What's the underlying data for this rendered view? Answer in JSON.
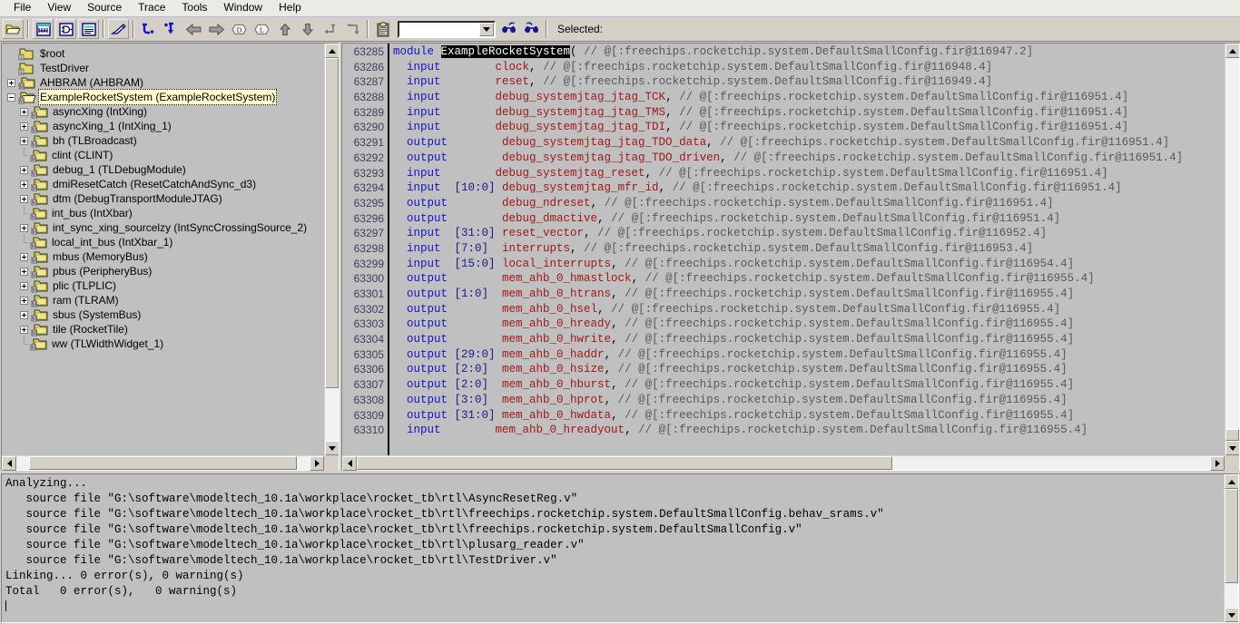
{
  "menu": {
    "items": [
      "File",
      "View",
      "Source",
      "Trace",
      "Tools",
      "Window",
      "Help"
    ]
  },
  "toolbar": {
    "buttons": [
      {
        "name": "open-folder-icon",
        "label": "Open"
      },
      {
        "name": "waveform-view-icon",
        "label": "Wave"
      },
      {
        "name": "schematic-view-icon",
        "label": "Schematic"
      },
      {
        "name": "list-view-icon",
        "label": "List"
      },
      {
        "name": "annotate-icon",
        "label": "Annotate"
      },
      {
        "name": "trace-forward-icon",
        "label": "Trace Forward"
      },
      {
        "name": "trace-backward-icon",
        "label": "Trace Backward"
      },
      {
        "name": "back-arrow-icon",
        "label": "Back"
      },
      {
        "name": "forward-arrow-icon",
        "label": "Forward"
      },
      {
        "name": "driver-icon",
        "label": "Show Drivers"
      },
      {
        "name": "load-icon",
        "label": "Show Loads"
      },
      {
        "name": "up-arrow-icon",
        "label": "Up"
      },
      {
        "name": "down-arrow-icon",
        "label": "Down"
      },
      {
        "name": "step-out-icon",
        "label": "Step Out"
      },
      {
        "name": "step-into-icon",
        "label": "Step Into"
      },
      {
        "name": "clipboard-icon",
        "label": "Paste Signal"
      }
    ],
    "combo_value": "",
    "combo_placeholder": "",
    "find_forward_icon": "binoculars-forward-icon",
    "find_backward_icon": "binoculars-backward-icon",
    "selected_label": "Selected:"
  },
  "tree": {
    "items": [
      {
        "indent": 1,
        "expander": "none",
        "icon": "root-folder-icon",
        "label": "$root",
        "selected": false
      },
      {
        "indent": 1,
        "expander": "none",
        "icon": "root-folder-icon",
        "label": "TestDriver",
        "selected": false
      },
      {
        "indent": 1,
        "expander": "plus",
        "icon": "module-folder-icon",
        "label": "AHBRAM (AHBRAM)",
        "selected": false
      },
      {
        "indent": 1,
        "expander": "minus",
        "icon": "module-open-folder-icon",
        "label": "ExampleRocketSystem (ExampleRocketSystem)",
        "selected": true
      },
      {
        "indent": 2,
        "expander": "plus",
        "icon": "module-folder-icon",
        "label": "asyncXing (IntXing)",
        "selected": false
      },
      {
        "indent": 2,
        "expander": "plus",
        "icon": "module-folder-icon",
        "label": "asyncXing_1 (IntXing_1)",
        "selected": false
      },
      {
        "indent": 2,
        "expander": "plus",
        "icon": "module-folder-icon",
        "label": "bh (TLBroadcast)",
        "selected": false
      },
      {
        "indent": 2,
        "expander": "leaf",
        "icon": "module-folder-icon",
        "label": "clint (CLINT)",
        "selected": false
      },
      {
        "indent": 2,
        "expander": "plus",
        "icon": "module-folder-icon",
        "label": "debug_1 (TLDebugModule)",
        "selected": false
      },
      {
        "indent": 2,
        "expander": "plus",
        "icon": "module-folder-icon",
        "label": "dmiResetCatch (ResetCatchAndSync_d3)",
        "selected": false
      },
      {
        "indent": 2,
        "expander": "plus",
        "icon": "module-folder-icon",
        "label": "dtm (DebugTransportModuleJTAG)",
        "selected": false
      },
      {
        "indent": 2,
        "expander": "leaf",
        "icon": "module-folder-icon",
        "label": "int_bus (IntXbar)",
        "selected": false
      },
      {
        "indent": 2,
        "expander": "plus",
        "icon": "module-folder-icon",
        "label": "int_sync_xing_sourcelzy (IntSyncCrossingSource_2)",
        "selected": false
      },
      {
        "indent": 2,
        "expander": "leaf",
        "icon": "module-folder-icon",
        "label": "local_int_bus (IntXbar_1)",
        "selected": false
      },
      {
        "indent": 2,
        "expander": "plus",
        "icon": "module-folder-icon",
        "label": "mbus (MemoryBus)",
        "selected": false
      },
      {
        "indent": 2,
        "expander": "plus",
        "icon": "module-folder-icon",
        "label": "pbus (PeripheryBus)",
        "selected": false
      },
      {
        "indent": 2,
        "expander": "plus",
        "icon": "module-folder-icon",
        "label": "plic (TLPLIC)",
        "selected": false
      },
      {
        "indent": 2,
        "expander": "plus",
        "icon": "module-folder-icon",
        "label": "ram (TLRAM)",
        "selected": false
      },
      {
        "indent": 2,
        "expander": "plus",
        "icon": "module-folder-icon",
        "label": "sbus (SystemBus)",
        "selected": false
      },
      {
        "indent": 2,
        "expander": "plus",
        "icon": "module-folder-icon",
        "label": "tile (RocketTile)",
        "selected": false
      },
      {
        "indent": 2,
        "expander": "leaf",
        "icon": "module-folder-icon",
        "label": "ww (TLWidthWidget_1)",
        "selected": false
      }
    ]
  },
  "source": {
    "first_line": 63285,
    "lines": [
      {
        "num": "63285",
        "tokens": [
          {
            "t": "kw",
            "v": "module "
          },
          {
            "t": "sel",
            "v": "ExampleRocketSystem"
          },
          {
            "t": "punct",
            "v": "("
          },
          {
            "t": "cmt",
            "v": " // @[:freechips.rocketchip.system.DefaultSmallConfig.fir@116947.2]"
          }
        ]
      },
      {
        "num": "63286",
        "tokens": [
          {
            "t": "kw",
            "v": "  input "
          },
          {
            "t": "width",
            "v": "       "
          },
          {
            "t": "ident",
            "v": "clock"
          },
          {
            "t": "punct",
            "v": ","
          },
          {
            "t": "cmt",
            "v": " // @[:freechips.rocketchip.system.DefaultSmallConfig.fir@116948.4]"
          }
        ]
      },
      {
        "num": "63287",
        "tokens": [
          {
            "t": "kw",
            "v": "  input "
          },
          {
            "t": "width",
            "v": "       "
          },
          {
            "t": "ident",
            "v": "reset"
          },
          {
            "t": "punct",
            "v": ","
          },
          {
            "t": "cmt",
            "v": " // @[:freechips.rocketchip.system.DefaultSmallConfig.fir@116949.4]"
          }
        ]
      },
      {
        "num": "63288",
        "tokens": [
          {
            "t": "kw",
            "v": "  input "
          },
          {
            "t": "width",
            "v": "       "
          },
          {
            "t": "ident",
            "v": "debug_systemjtag_jtag_TCK"
          },
          {
            "t": "punct",
            "v": ","
          },
          {
            "t": "cmt",
            "v": " // @[:freechips.rocketchip.system.DefaultSmallConfig.fir@116951.4]"
          }
        ]
      },
      {
        "num": "63289",
        "tokens": [
          {
            "t": "kw",
            "v": "  input "
          },
          {
            "t": "width",
            "v": "       "
          },
          {
            "t": "ident",
            "v": "debug_systemjtag_jtag_TMS"
          },
          {
            "t": "punct",
            "v": ","
          },
          {
            "t": "cmt",
            "v": " // @[:freechips.rocketchip.system.DefaultSmallConfig.fir@116951.4]"
          }
        ]
      },
      {
        "num": "63290",
        "tokens": [
          {
            "t": "kw",
            "v": "  input "
          },
          {
            "t": "width",
            "v": "       "
          },
          {
            "t": "ident",
            "v": "debug_systemjtag_jtag_TDI"
          },
          {
            "t": "punct",
            "v": ","
          },
          {
            "t": "cmt",
            "v": " // @[:freechips.rocketchip.system.DefaultSmallConfig.fir@116951.4]"
          }
        ]
      },
      {
        "num": "63291",
        "tokens": [
          {
            "t": "kw",
            "v": "  output"
          },
          {
            "t": "width",
            "v": "       "
          },
          {
            "t": "ident",
            "v": " debug_systemjtag_jtag_TDO_data"
          },
          {
            "t": "punct",
            "v": ","
          },
          {
            "t": "cmt",
            "v": " // @[:freechips.rocketchip.system.DefaultSmallConfig.fir@116951.4]"
          }
        ]
      },
      {
        "num": "63292",
        "tokens": [
          {
            "t": "kw",
            "v": "  output"
          },
          {
            "t": "width",
            "v": "       "
          },
          {
            "t": "ident",
            "v": " debug_systemjtag_jtag_TDO_driven"
          },
          {
            "t": "punct",
            "v": ","
          },
          {
            "t": "cmt",
            "v": " // @[:freechips.rocketchip.system.DefaultSmallConfig.fir@116951.4]"
          }
        ]
      },
      {
        "num": "63293",
        "tokens": [
          {
            "t": "kw",
            "v": "  input "
          },
          {
            "t": "width",
            "v": "       "
          },
          {
            "t": "ident",
            "v": "debug_systemjtag_reset"
          },
          {
            "t": "punct",
            "v": ","
          },
          {
            "t": "cmt",
            "v": " // @[:freechips.rocketchip.system.DefaultSmallConfig.fir@116951.4]"
          }
        ]
      },
      {
        "num": "63294",
        "tokens": [
          {
            "t": "kw",
            "v": "  input "
          },
          {
            "t": "width",
            "v": " [10:0]"
          },
          {
            "t": "ident",
            "v": " debug_systemjtag_mfr_id"
          },
          {
            "t": "punct",
            "v": ","
          },
          {
            "t": "cmt",
            "v": " // @[:freechips.rocketchip.system.DefaultSmallConfig.fir@116951.4]"
          }
        ]
      },
      {
        "num": "63295",
        "tokens": [
          {
            "t": "kw",
            "v": "  output"
          },
          {
            "t": "width",
            "v": "       "
          },
          {
            "t": "ident",
            "v": " debug_ndreset"
          },
          {
            "t": "punct",
            "v": ","
          },
          {
            "t": "cmt",
            "v": " // @[:freechips.rocketchip.system.DefaultSmallConfig.fir@116951.4]"
          }
        ]
      },
      {
        "num": "63296",
        "tokens": [
          {
            "t": "kw",
            "v": "  output"
          },
          {
            "t": "width",
            "v": "       "
          },
          {
            "t": "ident",
            "v": " debug_dmactive"
          },
          {
            "t": "punct",
            "v": ","
          },
          {
            "t": "cmt",
            "v": " // @[:freechips.rocketchip.system.DefaultSmallConfig.fir@116951.4]"
          }
        ]
      },
      {
        "num": "63297",
        "tokens": [
          {
            "t": "kw",
            "v": "  input "
          },
          {
            "t": "width",
            "v": " [31:0]"
          },
          {
            "t": "ident",
            "v": " reset_vector"
          },
          {
            "t": "punct",
            "v": ","
          },
          {
            "t": "cmt",
            "v": " // @[:freechips.rocketchip.system.DefaultSmallConfig.fir@116952.4]"
          }
        ]
      },
      {
        "num": "63298",
        "tokens": [
          {
            "t": "kw",
            "v": "  input "
          },
          {
            "t": "width",
            "v": " [7:0] "
          },
          {
            "t": "ident",
            "v": " interrupts"
          },
          {
            "t": "punct",
            "v": ","
          },
          {
            "t": "cmt",
            "v": " // @[:freechips.rocketchip.system.DefaultSmallConfig.fir@116953.4]"
          }
        ]
      },
      {
        "num": "63299",
        "tokens": [
          {
            "t": "kw",
            "v": "  input "
          },
          {
            "t": "width",
            "v": " [15:0]"
          },
          {
            "t": "ident",
            "v": " local_interrupts"
          },
          {
            "t": "punct",
            "v": ","
          },
          {
            "t": "cmt",
            "v": " // @[:freechips.rocketchip.system.DefaultSmallConfig.fir@116954.4]"
          }
        ]
      },
      {
        "num": "63300",
        "tokens": [
          {
            "t": "kw",
            "v": "  output"
          },
          {
            "t": "width",
            "v": "       "
          },
          {
            "t": "ident",
            "v": " mem_ahb_0_hmastlock"
          },
          {
            "t": "punct",
            "v": ","
          },
          {
            "t": "cmt",
            "v": " // @[:freechips.rocketchip.system.DefaultSmallConfig.fir@116955.4]"
          }
        ]
      },
      {
        "num": "63301",
        "tokens": [
          {
            "t": "kw",
            "v": "  output"
          },
          {
            "t": "width",
            "v": " [1:0] "
          },
          {
            "t": "ident",
            "v": " mem_ahb_0_htrans"
          },
          {
            "t": "punct",
            "v": ","
          },
          {
            "t": "cmt",
            "v": " // @[:freechips.rocketchip.system.DefaultSmallConfig.fir@116955.4]"
          }
        ]
      },
      {
        "num": "63302",
        "tokens": [
          {
            "t": "kw",
            "v": "  output"
          },
          {
            "t": "width",
            "v": "       "
          },
          {
            "t": "ident",
            "v": " mem_ahb_0_hsel"
          },
          {
            "t": "punct",
            "v": ","
          },
          {
            "t": "cmt",
            "v": " // @[:freechips.rocketchip.system.DefaultSmallConfig.fir@116955.4]"
          }
        ]
      },
      {
        "num": "63303",
        "tokens": [
          {
            "t": "kw",
            "v": "  output"
          },
          {
            "t": "width",
            "v": "       "
          },
          {
            "t": "ident",
            "v": " mem_ahb_0_hready"
          },
          {
            "t": "punct",
            "v": ","
          },
          {
            "t": "cmt",
            "v": " // @[:freechips.rocketchip.system.DefaultSmallConfig.fir@116955.4]"
          }
        ]
      },
      {
        "num": "63304",
        "tokens": [
          {
            "t": "kw",
            "v": "  output"
          },
          {
            "t": "width",
            "v": "       "
          },
          {
            "t": "ident",
            "v": " mem_ahb_0_hwrite"
          },
          {
            "t": "punct",
            "v": ","
          },
          {
            "t": "cmt",
            "v": " // @[:freechips.rocketchip.system.DefaultSmallConfig.fir@116955.4]"
          }
        ]
      },
      {
        "num": "63305",
        "tokens": [
          {
            "t": "kw",
            "v": "  output"
          },
          {
            "t": "width",
            "v": " [29:0]"
          },
          {
            "t": "ident",
            "v": " mem_ahb_0_haddr"
          },
          {
            "t": "punct",
            "v": ","
          },
          {
            "t": "cmt",
            "v": " // @[:freechips.rocketchip.system.DefaultSmallConfig.fir@116955.4]"
          }
        ]
      },
      {
        "num": "63306",
        "tokens": [
          {
            "t": "kw",
            "v": "  output"
          },
          {
            "t": "width",
            "v": " [2:0] "
          },
          {
            "t": "ident",
            "v": " mem_ahb_0_hsize"
          },
          {
            "t": "punct",
            "v": ","
          },
          {
            "t": "cmt",
            "v": " // @[:freechips.rocketchip.system.DefaultSmallConfig.fir@116955.4]"
          }
        ]
      },
      {
        "num": "63307",
        "tokens": [
          {
            "t": "kw",
            "v": "  output"
          },
          {
            "t": "width",
            "v": " [2:0] "
          },
          {
            "t": "ident",
            "v": " mem_ahb_0_hburst"
          },
          {
            "t": "punct",
            "v": ","
          },
          {
            "t": "cmt",
            "v": " // @[:freechips.rocketchip.system.DefaultSmallConfig.fir@116955.4]"
          }
        ]
      },
      {
        "num": "63308",
        "tokens": [
          {
            "t": "kw",
            "v": "  output"
          },
          {
            "t": "width",
            "v": " [3:0] "
          },
          {
            "t": "ident",
            "v": " mem_ahb_0_hprot"
          },
          {
            "t": "punct",
            "v": ","
          },
          {
            "t": "cmt",
            "v": " // @[:freechips.rocketchip.system.DefaultSmallConfig.fir@116955.4]"
          }
        ]
      },
      {
        "num": "63309",
        "tokens": [
          {
            "t": "kw",
            "v": "  output"
          },
          {
            "t": "width",
            "v": " [31:0]"
          },
          {
            "t": "ident",
            "v": " mem_ahb_0_hwdata"
          },
          {
            "t": "punct",
            "v": ","
          },
          {
            "t": "cmt",
            "v": " // @[:freechips.rocketchip.system.DefaultSmallConfig.fir@116955.4]"
          }
        ]
      },
      {
        "num": "63310",
        "tokens": [
          {
            "t": "kw",
            "v": "  input "
          },
          {
            "t": "width",
            "v": "       "
          },
          {
            "t": "ident",
            "v": "mem_ahb_0_hreadyout"
          },
          {
            "t": "punct",
            "v": ","
          },
          {
            "t": "cmt",
            "v": " // @[:freechips.rocketchip.system.DefaultSmallConfig.fir@116955.4]"
          }
        ]
      }
    ]
  },
  "transcript": {
    "lines": [
      "Analyzing...",
      "   source file \"G:\\software\\modeltech_10.1a\\workplace\\rocket_tb\\rtl\\AsyncResetReg.v\"",
      "   source file \"G:\\software\\modeltech_10.1a\\workplace\\rocket_tb\\rtl\\freechips.rocketchip.system.DefaultSmallConfig.behav_srams.v\"",
      "   source file \"G:\\software\\modeltech_10.1a\\workplace\\rocket_tb\\rtl\\freechips.rocketchip.system.DefaultSmallConfig.v\"",
      "   source file \"G:\\software\\modeltech_10.1a\\workplace\\rocket_tb\\rtl\\plusarg_reader.v\"",
      "   source file \"G:\\software\\modeltech_10.1a\\workplace\\rocket_tb\\rtl\\TestDriver.v\"",
      "Linking... 0 error(s), 0 warning(s)",
      "Total   0 error(s),   0 warning(s)"
    ]
  },
  "colors": {
    "window_bg": "#d4d0c8",
    "panel_bg": "#c0c0c0",
    "menu_bg": "#eceae5",
    "keyword": "#1414c8",
    "identifier": "#a01818",
    "comment": "#585858",
    "selection_bg": "#000000",
    "selection_fg": "#ffffff",
    "tree_selection_bg": "#ffffcc",
    "gutter_text": "#3a3f5c"
  }
}
